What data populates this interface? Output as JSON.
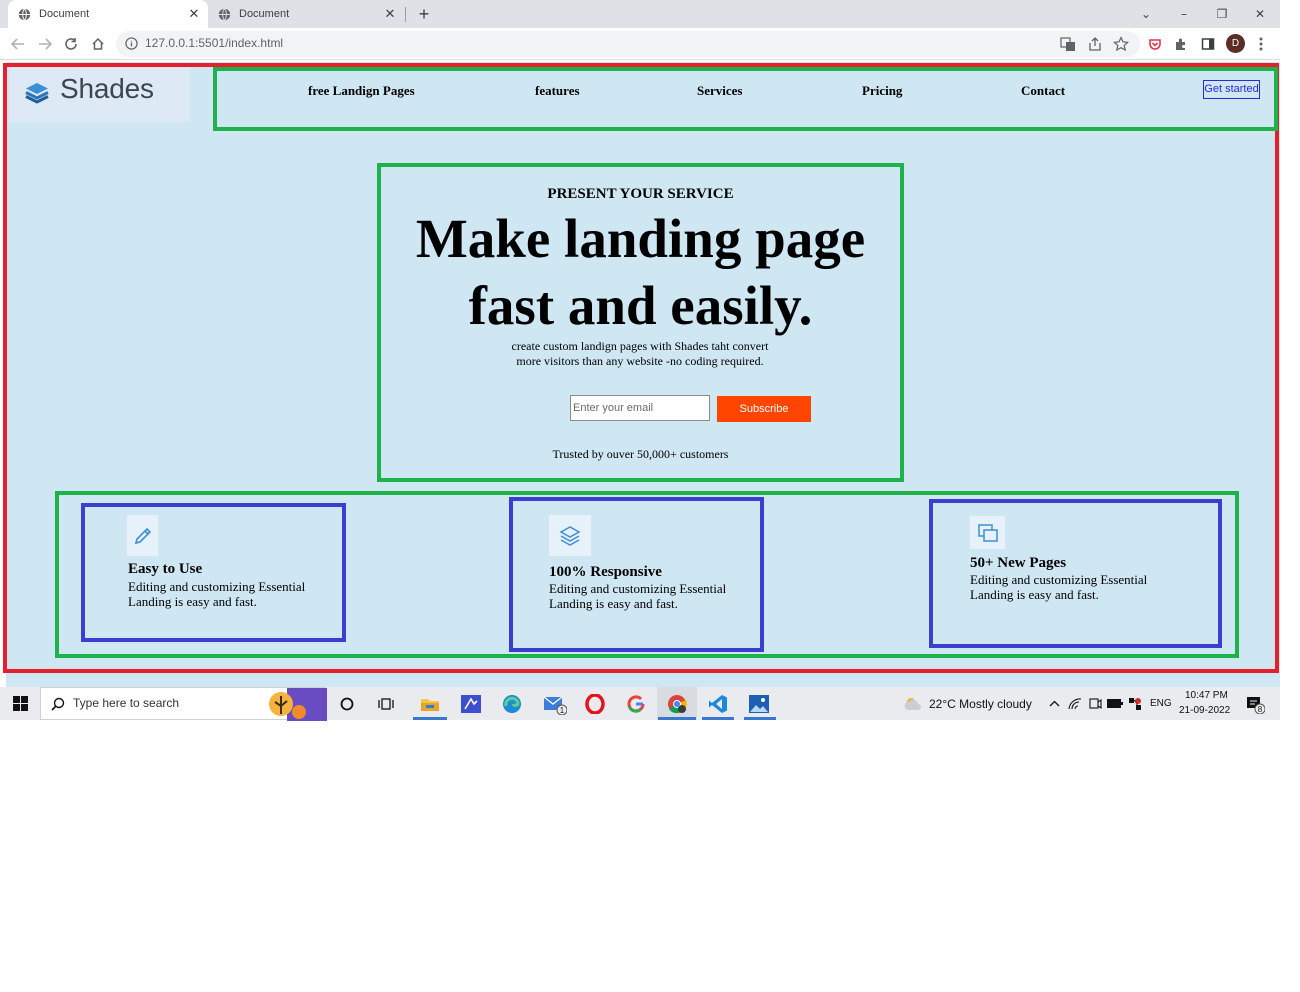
{
  "browser": {
    "tabs": [
      {
        "title": "Document"
      },
      {
        "title": "Document"
      }
    ],
    "url": "127.0.0.1:5501/index.html",
    "profile_initial": "D"
  },
  "site": {
    "brand": "Shades",
    "nav": [
      "free Landign Pages",
      "features",
      "Services",
      "Pricing",
      "Contact"
    ],
    "cta_label": "Get started",
    "hero": {
      "eyebrow": "PRESENT YOUR SERVICE",
      "headline_line1": "Make landing page",
      "headline_line2": "fast and easily.",
      "subtext_line1": "create custom landign pages with Shades taht convert",
      "subtext_line2": "more visitors than any website -no coding required.",
      "email_placeholder": "Enter your email",
      "subscribe_label": "Subscribe",
      "trusted": "Trusted by ouver 50,000+ customers"
    },
    "features": [
      {
        "icon": "pencil-icon",
        "title": "Easy to Use",
        "desc_line1": "Editing and customizing Essential",
        "desc_line2": "Landing is easy and fast."
      },
      {
        "icon": "layers-icon",
        "title": "100% Responsive",
        "desc_line1": "Editing and customizing Essential",
        "desc_line2": "Landing is easy and fast."
      },
      {
        "icon": "pages-icon",
        "title": "50+ New Pages",
        "desc_line1": "Editing and customizing Essential",
        "desc_line2": "Landing is easy and fast."
      }
    ]
  },
  "taskbar": {
    "search_placeholder": "Type here to search",
    "weather": "22°C  Mostly cloudy",
    "language": "ENG",
    "time": "10:47 PM",
    "date": "21-09-2022",
    "mail_badge": "1",
    "notification_badge": "8"
  },
  "colors": {
    "page_bg": "#cfe6f3",
    "annotation_red": "#e5202a",
    "annotation_green": "#1fb24a",
    "annotation_blue": "#3b3fd1",
    "subscribe_bg": "#ff4500",
    "cta_color": "#2a2ad8"
  }
}
